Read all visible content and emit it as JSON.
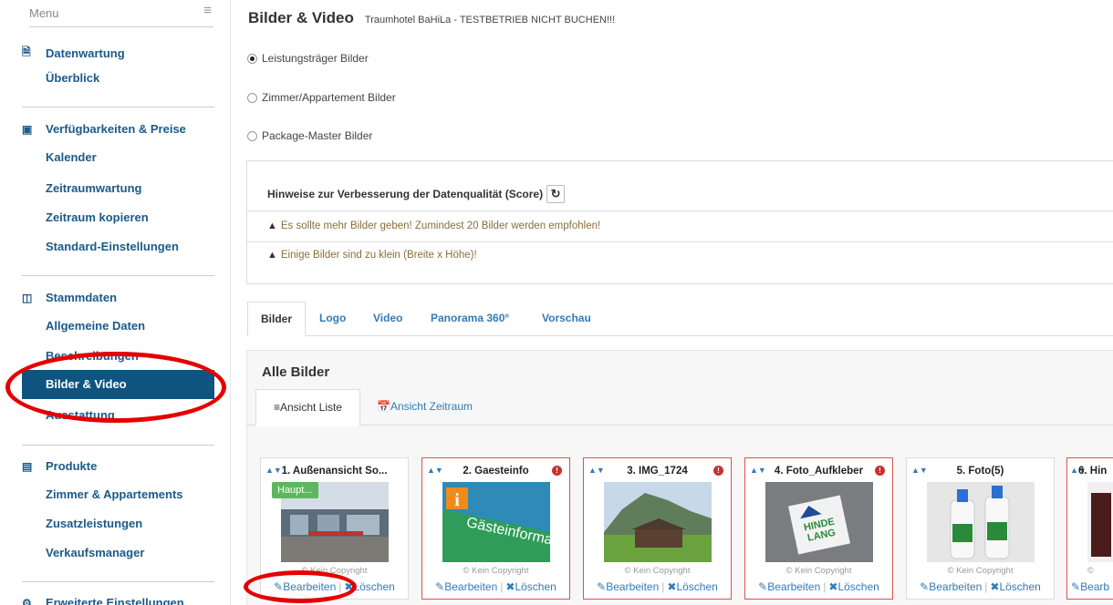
{
  "sidebar": {
    "menu_label": "Menu",
    "menu_icon": "hamburger-icon",
    "sections": [
      {
        "title": "Datenwartung",
        "icon": "document-icon",
        "items": [
          "Überblick"
        ]
      },
      {
        "title": "Verfügbarkeiten & Preise",
        "icon": "money-icon",
        "items": [
          "Kalender",
          "Zeitraumwartung",
          "Zeitraum kopieren",
          "Standard-Einstellungen"
        ]
      },
      {
        "title": "Stammdaten",
        "icon": "columns-icon",
        "items": [
          "Allgemeine Daten",
          "Beschreibungen",
          "Bilder & Video",
          "Ausstattung"
        ]
      },
      {
        "title": "Produkte",
        "icon": "bed-icon",
        "items": [
          "Zimmer & Appartements",
          "Zusatzleistungen",
          "Verkaufsmanager"
        ]
      },
      {
        "title": "Erweiterte Einstellungen",
        "icon": "gears-icon",
        "items": []
      }
    ],
    "active_item": "Bilder & Video"
  },
  "header": {
    "title": "Bilder & Video",
    "subtitle": "Traumhotel BaHiLa - TESTBETRIEB NICHT BUCHEN!!!"
  },
  "radios": [
    {
      "label": "Leistungsträger Bilder",
      "checked": true
    },
    {
      "label": "Zimmer/Appartement Bilder",
      "checked": false
    },
    {
      "label": "Package-Master Bilder",
      "checked": false
    }
  ],
  "hints": {
    "title": "Hinweise zur Verbesserung der Datenqualität (Score)",
    "items": [
      "Es sollte mehr Bilder geben! Zumindest 20 Bilder werden empfohlen!",
      "Einige Bilder sind zu klein (Breite x Höhe)!"
    ]
  },
  "tabs": [
    "Bilder",
    "Logo",
    "Video",
    "Panorama 360°",
    "Vorschau"
  ],
  "active_tab": "Bilder",
  "panel": {
    "title": "Alle Bilder",
    "subtabs": [
      "Ansicht Liste",
      "Ansicht Zeitraum"
    ]
  },
  "cards": [
    {
      "title": "1. Außenansicht So...",
      "badge": "Haupt...",
      "error": false,
      "copyright": "© Kein Copyright",
      "edit": "Bearbeiten",
      "delete": "Löschen"
    },
    {
      "title": "2. Gaesteinfo",
      "error": true,
      "copyright": "© Kein Copyright",
      "edit": "Bearbeiten",
      "delete": "Löschen"
    },
    {
      "title": "3. IMG_1724",
      "error": true,
      "copyright": "© Kein Copyright",
      "edit": "Bearbeiten",
      "delete": "Löschen"
    },
    {
      "title": "4. Foto_Aufkleber",
      "error": true,
      "copyright": "© Kein Copyright",
      "edit": "Bearbeiten",
      "delete": "Löschen"
    },
    {
      "title": "5. Foto(5)",
      "error": false,
      "copyright": "© Kein Copyright",
      "edit": "Bearbeiten",
      "delete": "Löschen"
    },
    {
      "title": "6. Hin",
      "error": true,
      "copyright": "©",
      "edit": "Bearb",
      "delete": ""
    }
  ],
  "thumb_text": {
    "sign": "Gästeinformation",
    "logo_top": "HINDE",
    "logo_bottom": "LANG"
  },
  "colors": {
    "primary": "#0f5481",
    "link": "#337ab7",
    "warning": "#8a6d3b",
    "danger": "#d9534f",
    "annotation": "#e50000"
  }
}
